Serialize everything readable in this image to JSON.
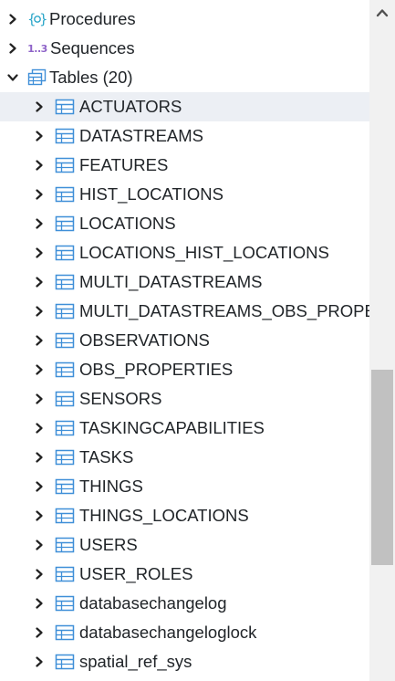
{
  "tree": {
    "procedures": {
      "label": "Procedures",
      "icon": "procedures-icon",
      "expanded": false
    },
    "sequences": {
      "label": "Sequences",
      "icon": "sequences-icon",
      "icon_text": "1..3",
      "expanded": false
    },
    "tables": {
      "label": "Tables (20)",
      "icon": "tables-icon",
      "expanded": true
    },
    "table_items": [
      {
        "label": "ACTUATORS"
      },
      {
        "label": "DATASTREAMS"
      },
      {
        "label": "FEATURES"
      },
      {
        "label": "HIST_LOCATIONS"
      },
      {
        "label": "LOCATIONS"
      },
      {
        "label": "LOCATIONS_HIST_LOCATIONS"
      },
      {
        "label": "MULTI_DATASTREAMS"
      },
      {
        "label": "MULTI_DATASTREAMS_OBS_PROPE"
      },
      {
        "label": "OBSERVATIONS"
      },
      {
        "label": "OBS_PROPERTIES"
      },
      {
        "label": "SENSORS"
      },
      {
        "label": "TASKINGCAPABILITIES"
      },
      {
        "label": "TASKS"
      },
      {
        "label": "THINGS"
      },
      {
        "label": "THINGS_LOCATIONS"
      },
      {
        "label": "USERS"
      },
      {
        "label": "USER_ROLES"
      },
      {
        "label": "databasechangelog"
      },
      {
        "label": "databasechangeloglock"
      },
      {
        "label": "spatial_ref_sys"
      }
    ],
    "selected_label": "ACTUATORS"
  },
  "colors": {
    "selected_row": "#eceff4",
    "table_icon": "#3f8fd8",
    "procedure_icon": "#2aa6c9",
    "sequence_icon": "#8e63c8",
    "text": "#212529"
  }
}
